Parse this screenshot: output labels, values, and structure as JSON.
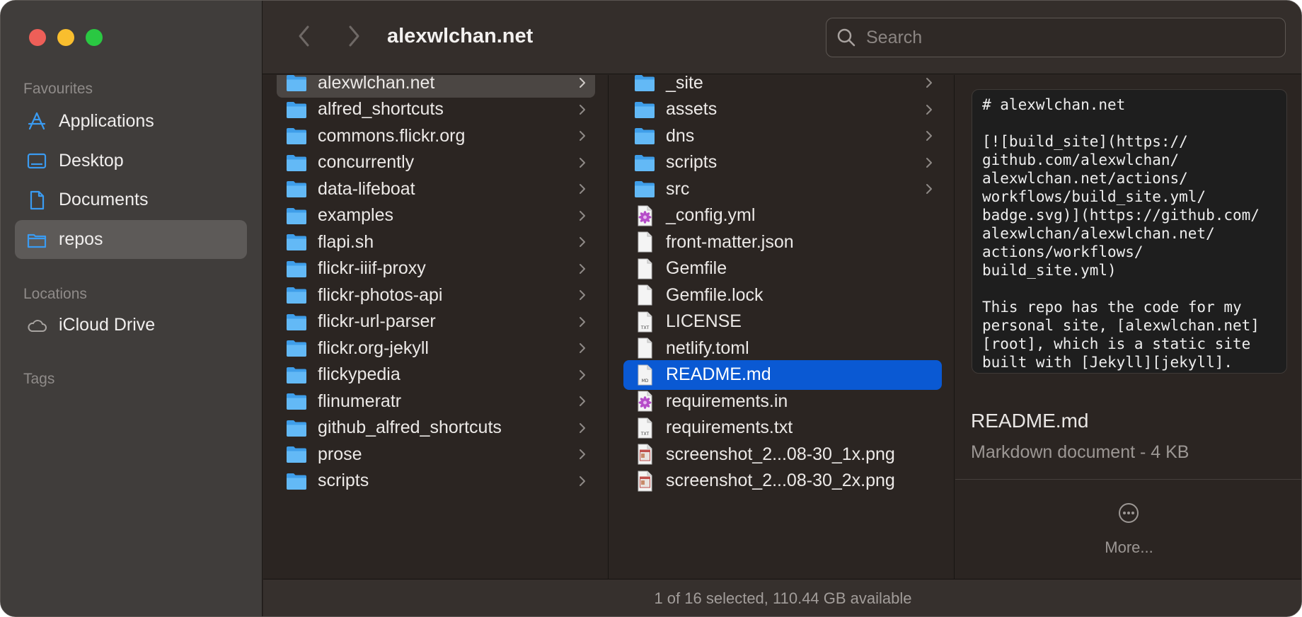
{
  "window": {
    "title": "alexwlchan.net"
  },
  "search": {
    "placeholder": "Search"
  },
  "sidebar": {
    "favourites_label": "Favourites",
    "favourites": [
      {
        "label": "Applications",
        "icon": "applications-icon"
      },
      {
        "label": "Desktop",
        "icon": "desktop-icon"
      },
      {
        "label": "Documents",
        "icon": "documents-icon"
      },
      {
        "label": "repos",
        "icon": "folder-icon",
        "active": true
      }
    ],
    "locations_label": "Locations",
    "locations": [
      {
        "label": "iCloud Drive",
        "icon": "cloud-icon"
      }
    ],
    "tags_label": "Tags"
  },
  "column1": [
    {
      "name": "alexwlchan.net",
      "kind": "folder",
      "selected": true
    },
    {
      "name": "alfred_shortcuts",
      "kind": "folder"
    },
    {
      "name": "commons.flickr.org",
      "kind": "folder"
    },
    {
      "name": "concurrently",
      "kind": "folder"
    },
    {
      "name": "data-lifeboat",
      "kind": "folder"
    },
    {
      "name": "examples",
      "kind": "folder"
    },
    {
      "name": "flapi.sh",
      "kind": "folder"
    },
    {
      "name": "flickr-iiif-proxy",
      "kind": "folder"
    },
    {
      "name": "flickr-photos-api",
      "kind": "folder"
    },
    {
      "name": "flickr-url-parser",
      "kind": "folder"
    },
    {
      "name": "flickr.org-jekyll",
      "kind": "folder"
    },
    {
      "name": "flickypedia",
      "kind": "folder"
    },
    {
      "name": "flinumeratr",
      "kind": "folder"
    },
    {
      "name": "github_alfred_shortcuts",
      "kind": "folder"
    },
    {
      "name": "prose",
      "kind": "folder"
    },
    {
      "name": "scripts",
      "kind": "folder"
    }
  ],
  "column2": [
    {
      "name": "_site",
      "kind": "folder"
    },
    {
      "name": "assets",
      "kind": "folder"
    },
    {
      "name": "dns",
      "kind": "folder"
    },
    {
      "name": "scripts",
      "kind": "folder"
    },
    {
      "name": "src",
      "kind": "folder"
    },
    {
      "name": "_config.yml",
      "kind": "yaml"
    },
    {
      "name": "front-matter.json",
      "kind": "doc"
    },
    {
      "name": "Gemfile",
      "kind": "doc"
    },
    {
      "name": "Gemfile.lock",
      "kind": "doc"
    },
    {
      "name": "LICENSE",
      "kind": "txt",
      "badge": "TXT"
    },
    {
      "name": "netlify.toml",
      "kind": "doc"
    },
    {
      "name": "README.md",
      "kind": "md",
      "badge": "MD",
      "selected": true
    },
    {
      "name": "requirements.in",
      "kind": "yaml"
    },
    {
      "name": "requirements.txt",
      "kind": "txt",
      "badge": "TXT"
    },
    {
      "name": "screenshot_2...08-30_1x.png",
      "kind": "image"
    },
    {
      "name": "screenshot_2...08-30_2x.png",
      "kind": "image"
    }
  ],
  "preview": {
    "content": "# alexwlchan.net\n\n[![build_site](https://\ngithub.com/alexwlchan/\nalexwlchan.net/actions/\nworkflows/build_site.yml/\nbadge.svg)](https://github.com/\nalexwlchan/alexwlchan.net/\nactions/workflows/\nbuild_site.yml)\n\nThis repo has the code for my\npersonal site, [alexwlchan.net]\n[root], which is a static site\nbuilt with [Jekyll][jekyll].\nI write the posts in Markdown,",
    "file_name": "README.md",
    "file_meta": "Markdown document - 4 KB",
    "more_label": "More..."
  },
  "status": {
    "text": "1 of 16 selected, 110.44 GB available"
  },
  "colors": {
    "accent": "#0a59d3",
    "folder": "#5cb6f4",
    "sidebar_icon": "#3a9bf1"
  }
}
